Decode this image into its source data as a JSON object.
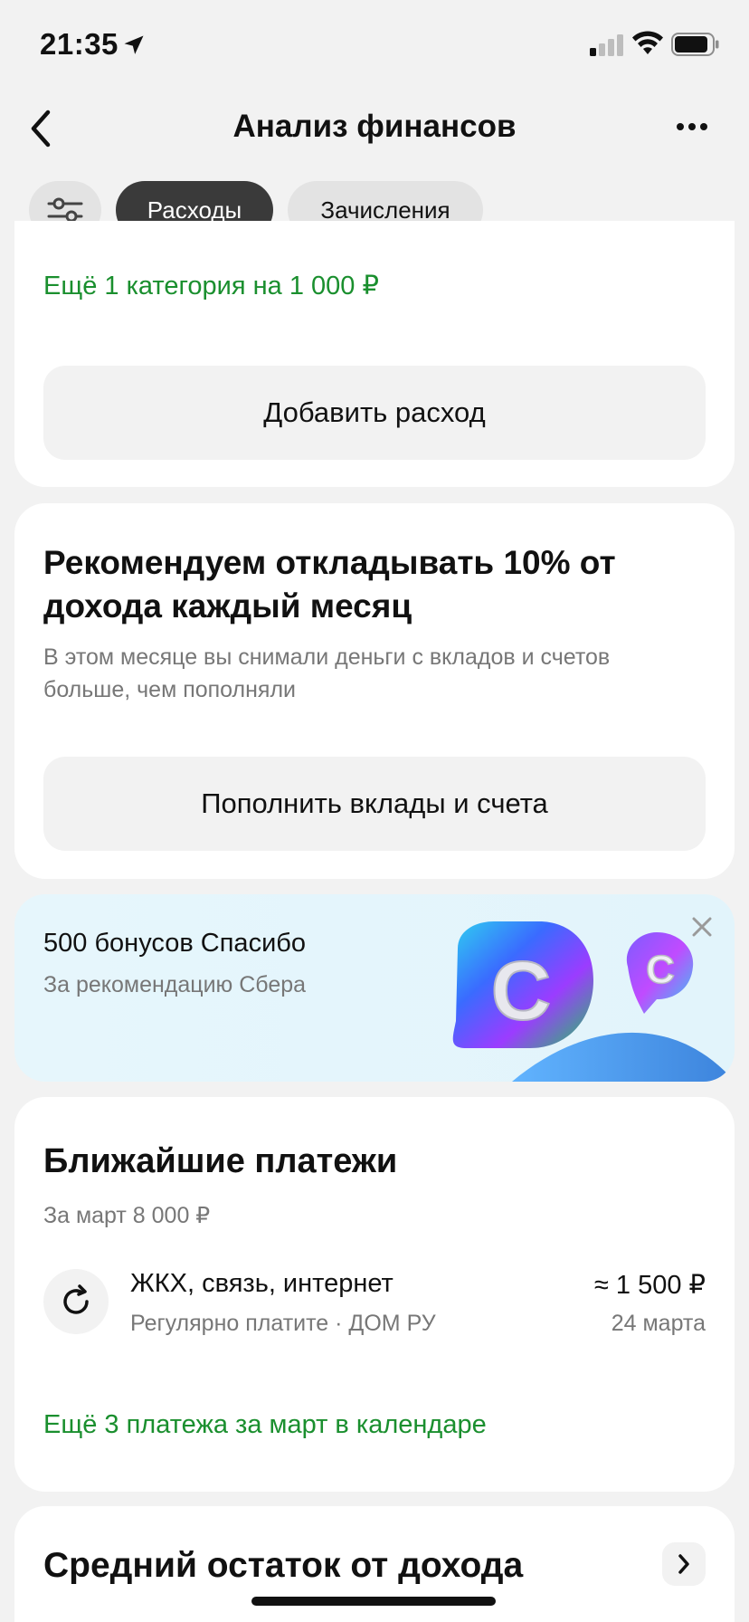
{
  "status_bar": {
    "time": "21:35",
    "icons": [
      "location-arrow-icon",
      "signal-icon",
      "wifi-icon",
      "battery-icon"
    ]
  },
  "nav": {
    "title": "Анализ финансов",
    "back_icon": "chevron-left-icon",
    "more_icon": "more-horizontal-icon"
  },
  "chips": {
    "filter_icon": "sliders-icon",
    "expenses": "Расходы",
    "income": "Зачисления",
    "active": "expenses"
  },
  "expenses_card": {
    "more_categories": "Ещё 1 категория на 1 000 ₽",
    "add_button": "Добавить расход"
  },
  "recommendation_card": {
    "title": "Рекомендуем откладывать 10% от дохода каждый месяц",
    "subtitle": "В этом месяце вы снимали деньги с вкладов и счетов больше, чем пополняли",
    "button": "Пополнить вклады и счета"
  },
  "promo_card": {
    "title": "500 бонусов Спасибо",
    "subtitle": "За рекомендацию Сбера",
    "close_icon": "close-icon"
  },
  "payments_card": {
    "title": "Ближайшие платежи",
    "subtitle": "За март 8 000 ₽",
    "items": [
      {
        "icon": "refresh-icon",
        "name": "ЖКХ, связь, интернет",
        "meta": "Регулярно платите · ДОМ РУ",
        "amount": "≈ 1 500 ₽",
        "date": "24 марта"
      }
    ],
    "more_link": "Ещё 3 платежа за март в календаре"
  },
  "avg_card": {
    "title": "Средний остаток от дохода",
    "arrow_icon": "chevron-right-icon"
  },
  "colors": {
    "accent_green": "#1a8f2e",
    "chip_active": "#3a3a3a",
    "background": "#f2f2f2"
  }
}
